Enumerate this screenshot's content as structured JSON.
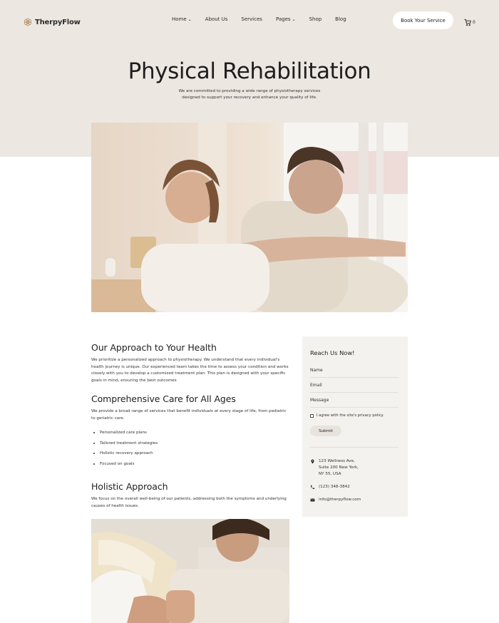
{
  "brand": {
    "name": "TherpyFlow"
  },
  "nav": {
    "items": [
      {
        "label": "Home",
        "dropdown": true
      },
      {
        "label": "About Us",
        "dropdown": false
      },
      {
        "label": "Services",
        "dropdown": false
      },
      {
        "label": "Pages",
        "dropdown": true
      },
      {
        "label": "Shop",
        "dropdown": false
      },
      {
        "label": "Blog",
        "dropdown": false
      }
    ],
    "cta_label": "Book Your Service",
    "cart_count": "0"
  },
  "hero": {
    "title": "Physical Rehabilitation",
    "subtitle": "We are committed to providing a wide range of physiotherapy services designed to support your recovery and enhance your quality of life."
  },
  "content": {
    "approach": {
      "heading": "Our Approach to Your Health",
      "body": "We prioritize a personalized approach to physiotherapy. We understand that every individual's health journey is unique. Our experienced team takes the time to assess your condition and works closely with you to develop a customized treatment plan. This plan is designed with your specific goals in mind, ensuring the best outcomes"
    },
    "care": {
      "heading": "Comprehensive Care for All Ages",
      "body": "We provide a broad range of services that benefit individuals at every stage of life, from pediatric to geriatric care.",
      "bullets": [
        "Personalized care plans",
        "Tailored treatment strategies",
        "Holistic recovery approach",
        "Focused on goals"
      ]
    },
    "holistic": {
      "heading": "Holistic Approach",
      "body": "We focus on the overall well-being of our patients, addressing both the symptoms and underlying causes of health issues."
    }
  },
  "sidebar": {
    "title": "Reach Us Now!",
    "fields": {
      "name": "Name",
      "email": "Email",
      "message": "Message"
    },
    "checkbox_label": "I agree with the site's privacy policy.",
    "submit_label": "Submit",
    "address_lines": [
      "123 Wellness Ave,",
      "Suite 200 New York,",
      "NY 55, USA"
    ],
    "phone": "(123) 348-3842",
    "email": "info@therpyflow.com"
  },
  "icons": [
    "flower-logo-icon",
    "chevron-down-icon",
    "cart-icon",
    "location-pin-icon",
    "phone-icon",
    "mail-icon"
  ],
  "colors": {
    "hero_bg": "#ece7e1",
    "sidebar_bg": "#f4f2ef",
    "button_bg": "#ffffff",
    "submit_bg": "#e8e3dc",
    "text": "#222222"
  }
}
